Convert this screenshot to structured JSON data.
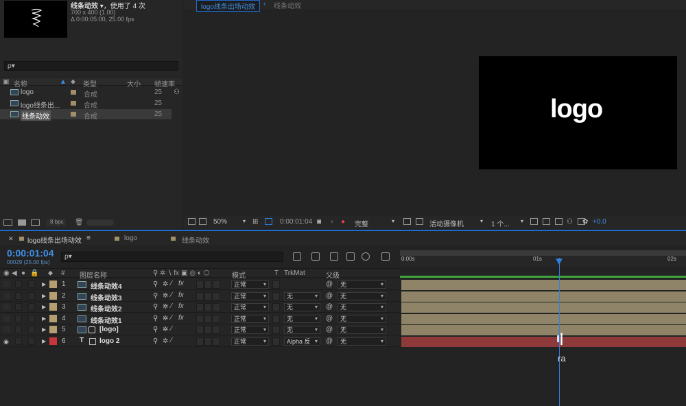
{
  "project": {
    "item_name": "线条动效",
    "usage": "，使用了 4 次",
    "dimensions": "700 x 400 (1.00)",
    "duration": "Δ 0:00:05:00, 25.00 fps",
    "search_placeholder": "ρ▾",
    "columns": {
      "name": "名称",
      "type": "类型",
      "size": "大小",
      "framerate": "帧速率"
    },
    "items": [
      {
        "name": "logo",
        "type": "合成",
        "fps": "25"
      },
      {
        "name": "logo线条出...",
        "type": "合成",
        "fps": "25"
      },
      {
        "name": "线条动效",
        "type": "合成",
        "fps": "25"
      }
    ],
    "bpc": "8 bpc"
  },
  "composition": {
    "tabs": [
      "logo线条出场动效",
      "线条动效"
    ],
    "logo_text": "logo",
    "zoom": "50%",
    "timecode": "0:00:01:04",
    "resolution": "完整",
    "camera": "活动摄像机",
    "views": "1 个...",
    "exposure": "+0.0"
  },
  "timeline": {
    "tabs": [
      "logo线条出场动效",
      "logo",
      "线条动效"
    ],
    "timecode": "0:00:01:04",
    "frames": "00029 (25.00 fps)",
    "search_placeholder": "ρ▾",
    "headers": {
      "hash": "#",
      "layer_name": "图层名称",
      "mode": "模式",
      "t": "T",
      "trkmat": "TrkMat",
      "parent": "父级"
    },
    "ruler": [
      "0:00s",
      "01s",
      "02s"
    ],
    "layers": [
      {
        "num": "1",
        "name": "线条动效4",
        "mode": "正常",
        "trkmat": "",
        "parent": "无",
        "color": "#b49e72"
      },
      {
        "num": "2",
        "name": "线条动效3",
        "mode": "正常",
        "trkmat": "无",
        "parent": "无",
        "color": "#b49e72"
      },
      {
        "num": "3",
        "name": "线条动效2",
        "mode": "正常",
        "trkmat": "无",
        "parent": "无",
        "color": "#b49e72"
      },
      {
        "num": "4",
        "name": "线条动效1",
        "mode": "正常",
        "trkmat": "无",
        "parent": "无",
        "color": "#b49e72"
      },
      {
        "num": "5",
        "name": "[logo]",
        "mode": "正常",
        "trkmat": "无",
        "parent": "无",
        "color": "#b49e72"
      },
      {
        "num": "6",
        "name": "logo 2",
        "mode": "正常",
        "trkmat": "Alpha 反",
        "parent": "无",
        "color": "#c8363a"
      }
    ]
  },
  "colors": {
    "accent": "#2f82e2",
    "bar_tan": "#8f8468",
    "bar_red": "#8f3a3a",
    "green": "#3da63f"
  }
}
